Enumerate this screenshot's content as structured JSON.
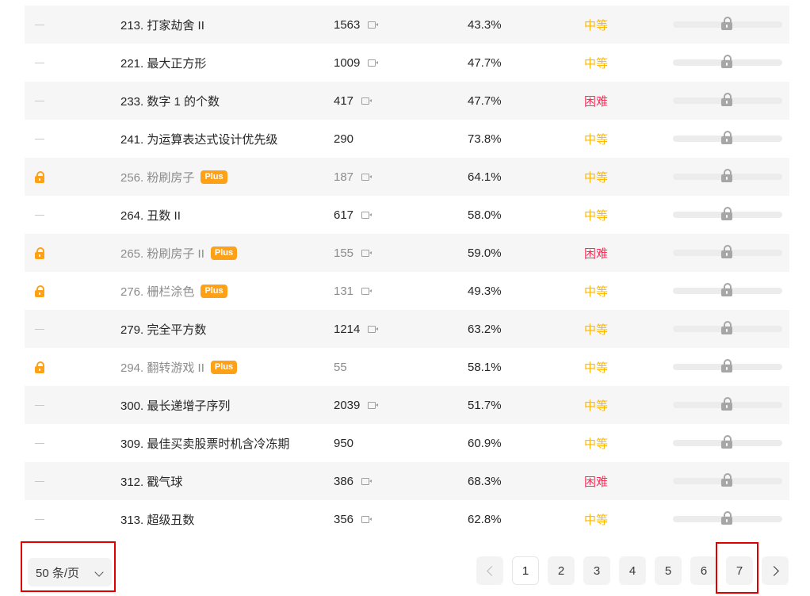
{
  "problems": [
    {
      "status": "none",
      "title": "213. 打家劫舍 II",
      "plus": false,
      "solutions": "1563",
      "video": true,
      "rate": "43.3%",
      "difficulty": "中等",
      "level": "medium"
    },
    {
      "status": "none",
      "title": "221. 最大正方形",
      "plus": false,
      "solutions": "1009",
      "video": true,
      "rate": "47.7%",
      "difficulty": "中等",
      "level": "medium"
    },
    {
      "status": "none",
      "title": "233. 数字 1 的个数",
      "plus": false,
      "solutions": "417",
      "video": true,
      "rate": "47.7%",
      "difficulty": "困难",
      "level": "hard"
    },
    {
      "status": "none",
      "title": "241. 为运算表达式设计优先级",
      "plus": false,
      "solutions": "290",
      "video": false,
      "rate": "73.8%",
      "difficulty": "中等",
      "level": "medium"
    },
    {
      "status": "locked",
      "title": "256. 粉刷房子",
      "plus": true,
      "solutions": "187",
      "video": true,
      "rate": "64.1%",
      "difficulty": "中等",
      "level": "medium"
    },
    {
      "status": "none",
      "title": "264. 丑数 II",
      "plus": false,
      "solutions": "617",
      "video": true,
      "rate": "58.0%",
      "difficulty": "中等",
      "level": "medium"
    },
    {
      "status": "locked",
      "title": "265. 粉刷房子 II",
      "plus": true,
      "solutions": "155",
      "video": true,
      "rate": "59.0%",
      "difficulty": "困难",
      "level": "hard"
    },
    {
      "status": "locked",
      "title": "276. 栅栏涂色",
      "plus": true,
      "solutions": "131",
      "video": true,
      "rate": "49.3%",
      "difficulty": "中等",
      "level": "medium"
    },
    {
      "status": "none",
      "title": "279. 完全平方数",
      "plus": false,
      "solutions": "1214",
      "video": true,
      "rate": "63.2%",
      "difficulty": "中等",
      "level": "medium"
    },
    {
      "status": "locked",
      "title": "294. 翻转游戏 II",
      "plus": true,
      "solutions": "55",
      "video": false,
      "rate": "58.1%",
      "difficulty": "中等",
      "level": "medium"
    },
    {
      "status": "none",
      "title": "300. 最长递增子序列",
      "plus": false,
      "solutions": "2039",
      "video": true,
      "rate": "51.7%",
      "difficulty": "中等",
      "level": "medium"
    },
    {
      "status": "none",
      "title": "309. 最佳买卖股票时机含冷冻期",
      "plus": false,
      "solutions": "950",
      "video": false,
      "rate": "60.9%",
      "difficulty": "中等",
      "level": "medium"
    },
    {
      "status": "none",
      "title": "312. 戳气球",
      "plus": false,
      "solutions": "386",
      "video": true,
      "rate": "68.3%",
      "difficulty": "困难",
      "level": "hard"
    },
    {
      "status": "none",
      "title": "313. 超级丑数",
      "plus": false,
      "solutions": "356",
      "video": true,
      "rate": "62.8%",
      "difficulty": "中等",
      "level": "medium"
    }
  ],
  "plus_label": "Plus",
  "pagination": {
    "page_size_label": "50 条/页",
    "pages": [
      "1",
      "2",
      "3",
      "4",
      "5",
      "6",
      "7"
    ],
    "current": "1"
  },
  "colors": {
    "medium": "#ffb800",
    "hard": "#ff2d55",
    "plus": "#ffa116"
  },
  "icons": {
    "status_locked": "lock-icon",
    "video": "video-icon",
    "frequency": "lock-icon",
    "prev": "chevron-left-icon",
    "next": "chevron-right-icon",
    "dropdown": "chevron-down-icon"
  }
}
